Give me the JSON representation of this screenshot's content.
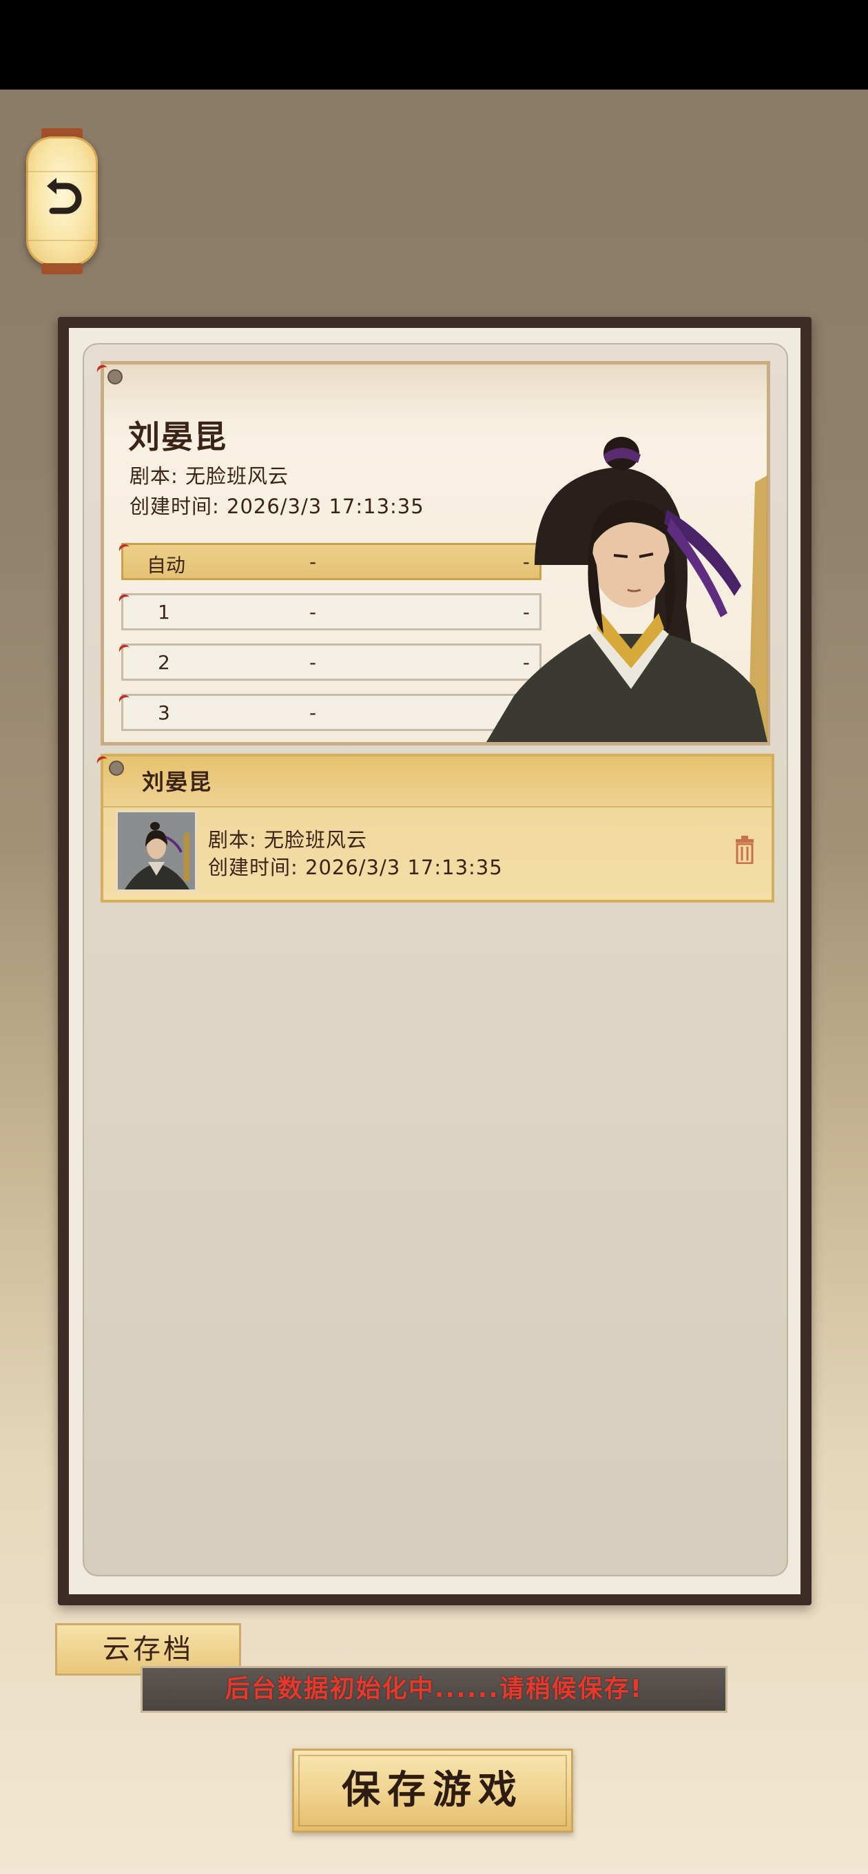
{
  "selected": {
    "name": "刘晏昆",
    "script_line": "剧本: 无脸班风云",
    "created_line": "创建时间: 2026/3/3 17:13:35"
  },
  "slots": [
    {
      "label": "自动",
      "mid": "-",
      "end": "-",
      "selected": true
    },
    {
      "label": "1",
      "mid": "-",
      "end": "-",
      "selected": false
    },
    {
      "label": "2",
      "mid": "-",
      "end": "-",
      "selected": false
    },
    {
      "label": "3",
      "mid": "-",
      "end": "-",
      "selected": false
    }
  ],
  "saves": [
    {
      "name": "刘晏昆",
      "script_line": "剧本: 无脸班风云",
      "created_line": "创建时间: 2026/3/3 17:13:35"
    }
  ],
  "bottom": {
    "cloud_tab": "云存档",
    "notice": "后台数据初始化中......请稍候保存!",
    "save_button": "保存游戏"
  },
  "icons": {
    "back": "back-arrow-icon",
    "delete": "trash-icon"
  },
  "colors": {
    "notice_text": "#e6392d",
    "frame": "#3d2b26",
    "selected_slot": "#e4c273"
  }
}
